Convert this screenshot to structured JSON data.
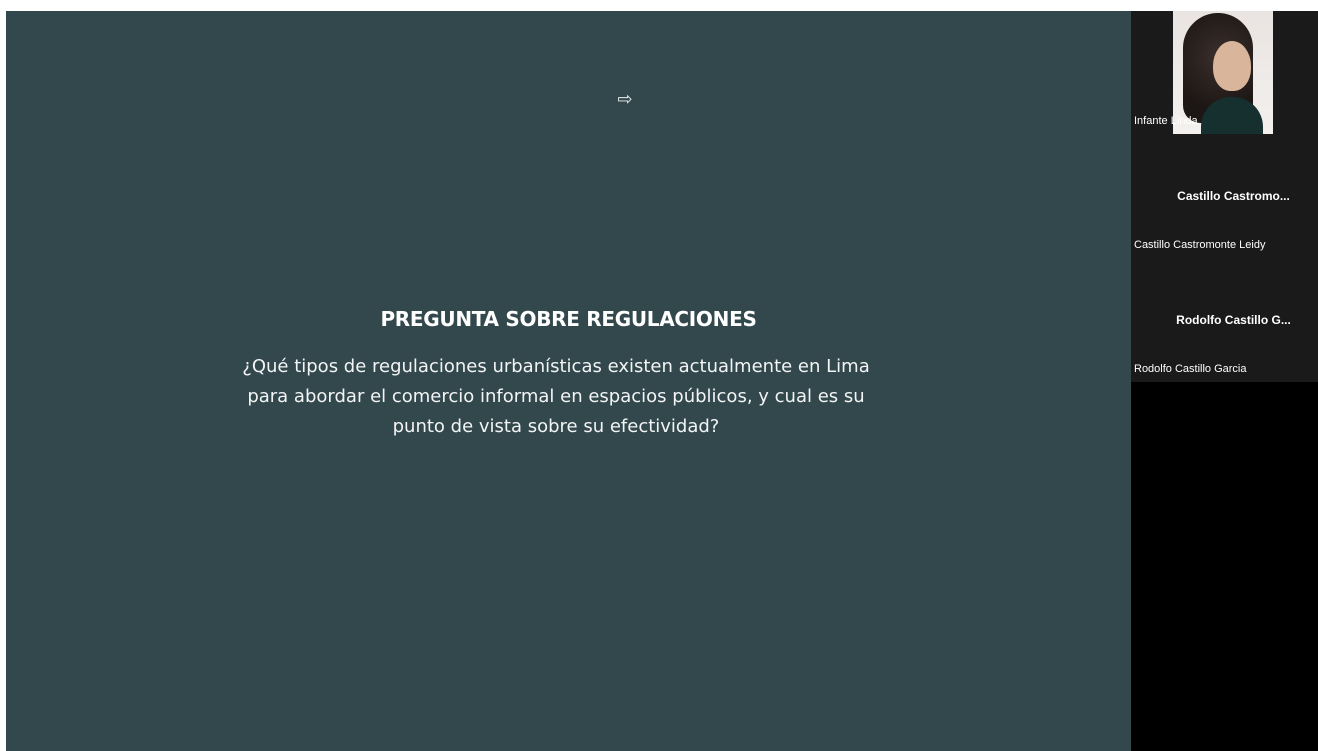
{
  "slide": {
    "title": "PREGUNTA SOBRE REGULACIONES",
    "question_line1": "¿Qué tipos de regulaciones urbanísticas existen actualmente en Lima",
    "question_line2": "para abordar el comercio informal en espacios públicos, y cual es su",
    "question_line3": "punto de vista sobre su efectividad?",
    "cursor_icon": "arrow-cursor-icon",
    "background_color": "#33484d"
  },
  "participants": [
    {
      "name_label": "Infante Linda",
      "has_video": true
    },
    {
      "display_name": "Castillo  Castromo...",
      "name_label": "Castillo Castromonte Leidy",
      "has_video": false
    },
    {
      "display_name": "Rodolfo  Castillo  G...",
      "name_label": "Rodolfo Castillo Garcia",
      "has_video": false
    }
  ]
}
